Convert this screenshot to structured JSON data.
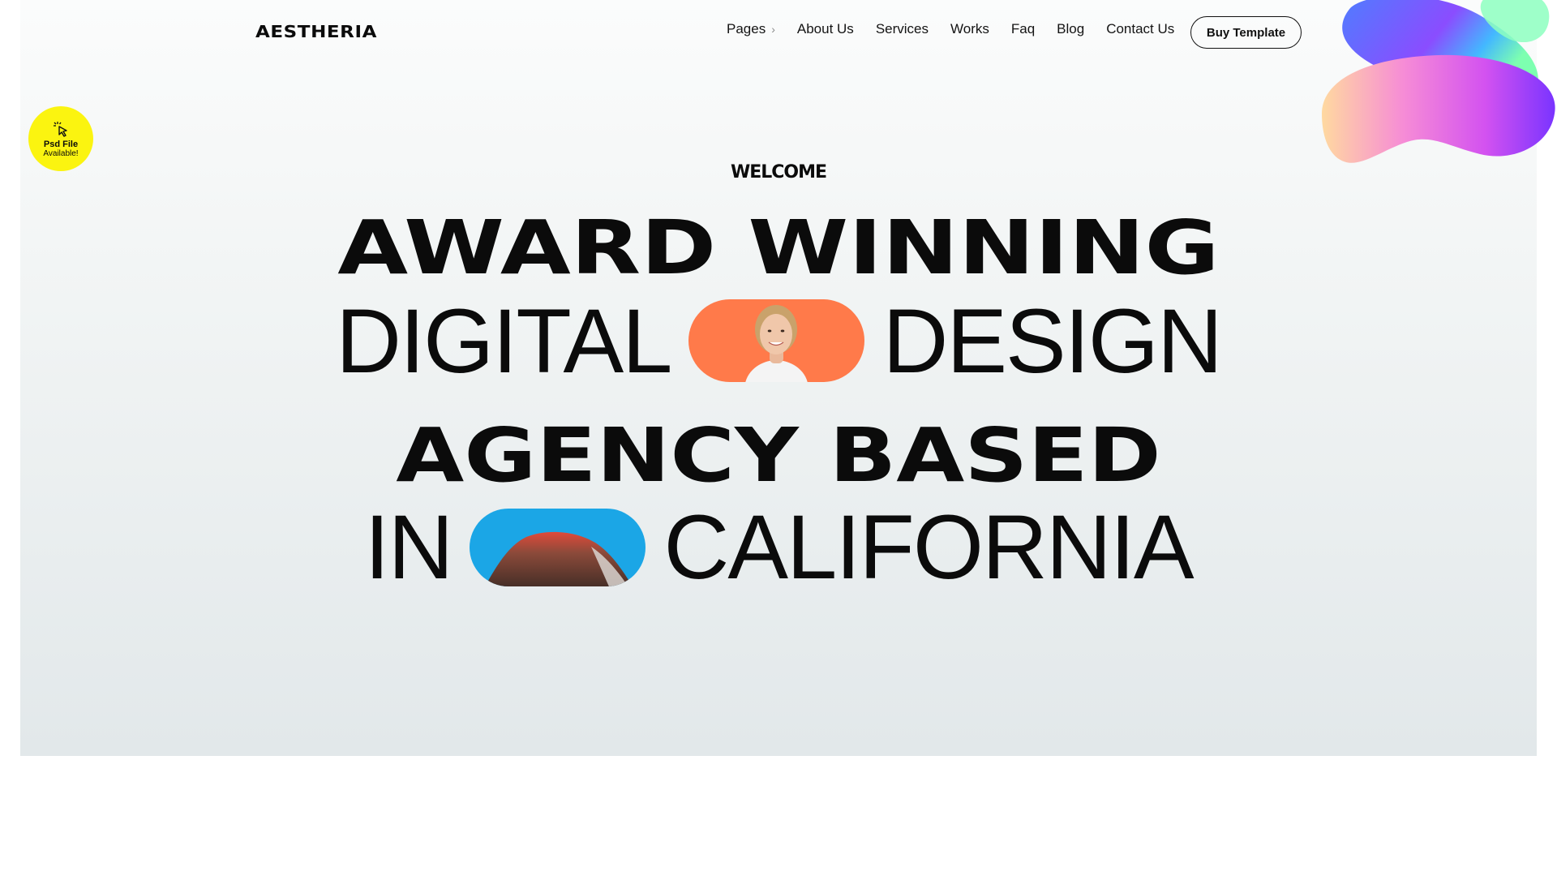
{
  "brand": {
    "logo": "AESTHERIA"
  },
  "nav": {
    "items": [
      {
        "label": "Pages",
        "icon": "chevron-right-icon"
      },
      {
        "label": "About Us"
      },
      {
        "label": "Services"
      },
      {
        "label": "Works"
      },
      {
        "label": "Faq"
      },
      {
        "label": "Blog"
      },
      {
        "label": "Contact Us"
      }
    ],
    "cta_label": "Buy Template"
  },
  "badge": {
    "icon": "cursor-click-icon",
    "line1": "Psd File",
    "line2": "Available!",
    "color": "#fbf410"
  },
  "hero": {
    "eyebrow": "WELCOME",
    "line1": "AWARD WINNING",
    "line2_left": "DIGITAL",
    "line2_right": "DESIGN",
    "line3": "AGENCY BASED",
    "line4_left": "IN",
    "line4_right": "CALIFORNIA",
    "pill1": {
      "image": "smiling-woman-portrait",
      "color": "#ff7a4a"
    },
    "pill2": {
      "image": "half-dome-mountain",
      "color": "#1ba6e6"
    }
  },
  "colors": {
    "background_top": "#fbfcfc",
    "background_bottom": "#e2e8ea",
    "text": "#0b0b0b"
  }
}
